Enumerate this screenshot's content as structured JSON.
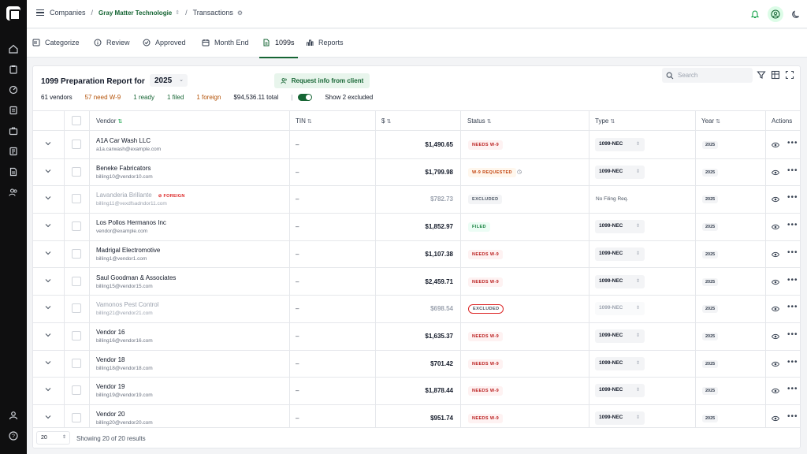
{
  "breadcrumb": {
    "companies": "Companies",
    "company": "Gray Matter Technologie",
    "page": "Transactions"
  },
  "tabs": [
    {
      "label": "Categorize",
      "icon": "categorize-icon"
    },
    {
      "label": "Review",
      "icon": "info-icon"
    },
    {
      "label": "Approved",
      "icon": "check-circle-icon"
    },
    {
      "label": "Month End",
      "icon": "calendar-icon"
    },
    {
      "label": "1099s",
      "icon": "document-icon",
      "active": true
    },
    {
      "label": "Reports",
      "icon": "bar-chart-icon"
    }
  ],
  "report": {
    "title": "1099 Preparation Report for",
    "year": "2025",
    "request_button": "Request info from client",
    "search_placeholder": "Search"
  },
  "stats": {
    "vendors": "61 vendors",
    "need_w9": "57 need W-9",
    "ready": "1 ready",
    "filed": "1 filed",
    "foreign": "1 foreign",
    "total": "$94,536.11 total",
    "pipe": "|",
    "show_excluded": "Show 2 excluded"
  },
  "columns": {
    "vendor": "Vendor",
    "tin": "TIN",
    "amount": "$",
    "status": "Status",
    "type": "Type",
    "year": "Year",
    "actions": "Actions"
  },
  "rows": [
    {
      "name": "A1A Car Wash LLC",
      "email": "a1a.carwash@example.com",
      "tin": "–",
      "amount": "$1,490.65",
      "status": "NEEDS W-9",
      "type": "1099-NEC",
      "year": "2025"
    },
    {
      "name": "Beneke Fabricators",
      "email": "billing10@vendor10.com",
      "tin": "–",
      "amount": "$1,799.98",
      "status": "W-9 REQUESTED",
      "type": "1099-NEC",
      "year": "2025"
    },
    {
      "name": "Lavanderia Brillante",
      "email": "billing11@vexdfsadndor11.com",
      "foreign": "FOREIGN",
      "tin": "–",
      "amount": "$782.73",
      "status": "EXCLUDED",
      "type": "No Filing Req.",
      "year": "2025"
    },
    {
      "name": "Los Pollos Hermanos Inc",
      "email": "vendor@example.com",
      "tin": "–",
      "amount": "$1,852.97",
      "status": "FILED",
      "type": "1099-NEC",
      "year": "2025"
    },
    {
      "name": "Madrigal Electromotive",
      "email": "billing1@vendor1.com",
      "tin": "–",
      "amount": "$1,107.38",
      "status": "NEEDS W-9",
      "type": "1099-NEC",
      "year": "2025"
    },
    {
      "name": "Saul Goodman & Associates",
      "email": "billing15@vendor15.com",
      "tin": "–",
      "amount": "$2,459.71",
      "status": "NEEDS W-9",
      "type": "1099-NEC",
      "year": "2025"
    },
    {
      "name": "Vamonos Pest Control",
      "email": "billing21@vendor21.com",
      "tin": "–",
      "amount": "$698.54",
      "status": "EXCLUDED",
      "type": "1099-NEC",
      "year": "2025"
    },
    {
      "name": "Vendor 16",
      "email": "billing16@vendor16.com",
      "tin": "–",
      "amount": "$1,635.37",
      "status": "NEEDS W-9",
      "type": "1099-NEC",
      "year": "2025"
    },
    {
      "name": "Vendor 18",
      "email": "billing18@vendor18.com",
      "tin": "–",
      "amount": "$701.42",
      "status": "NEEDS W-9",
      "type": "1099-NEC",
      "year": "2025"
    },
    {
      "name": "Vendor 19",
      "email": "billing19@vendor19.com",
      "tin": "–",
      "amount": "$1,878.44",
      "status": "NEEDS W-9",
      "type": "1099-NEC",
      "year": "2025"
    },
    {
      "name": "Vendor 20",
      "email": "billing20@vendor20.com",
      "tin": "–",
      "amount": "$951.74",
      "status": "NEEDS W-9",
      "type": "1099-NEC",
      "year": "2025"
    }
  ],
  "footer": {
    "page_size": "20",
    "showing": "Showing 20 of 20 results"
  },
  "colors": {
    "brand": "#166534",
    "rail": "#0f0f10",
    "needs_w9": "#b91c1c",
    "requested": "#c2410c",
    "filed": "#15803d",
    "highlight": "#dc2626"
  }
}
